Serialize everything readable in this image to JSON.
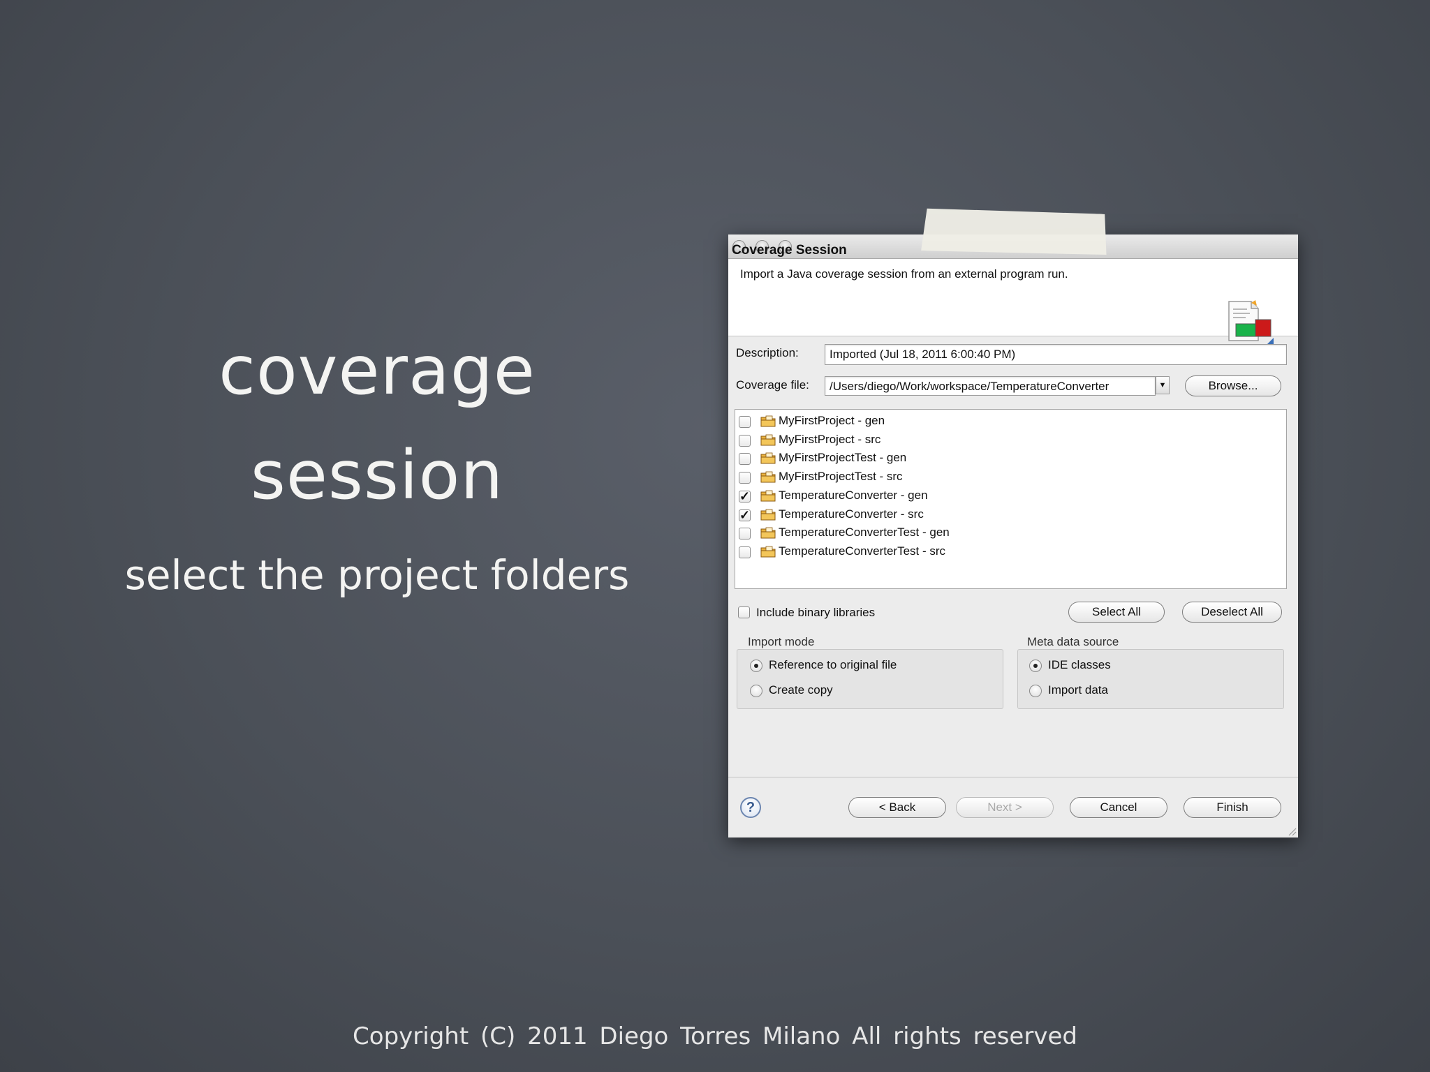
{
  "slide": {
    "title_line1": "coverage",
    "title_line2": "session",
    "subtitle": "select the project folders",
    "copyright": "Copyright (C) 2011  Diego Torres Milano  All rights reserved"
  },
  "dialog": {
    "header_title": "Coverage Session",
    "header_description": "Import a Java coverage session from an external program run.",
    "description_label": "Description:",
    "description_value": "Imported (Jul 18, 2011 6:00:40 PM)",
    "coverage_file_label": "Coverage file:",
    "coverage_file_value": "/Users/diego/Work/workspace/TemperatureConverter",
    "browse_label": "Browse...",
    "folders": [
      {
        "label": "MyFirstProject - gen",
        "checked": false
      },
      {
        "label": "MyFirstProject - src",
        "checked": false
      },
      {
        "label": "MyFirstProjectTest - gen",
        "checked": false
      },
      {
        "label": "MyFirstProjectTest - src",
        "checked": false
      },
      {
        "label": "TemperatureConverter - gen",
        "checked": true
      },
      {
        "label": "TemperatureConverter - src",
        "checked": true
      },
      {
        "label": "TemperatureConverterTest - gen",
        "checked": false
      },
      {
        "label": "TemperatureConverterTest - src",
        "checked": false
      }
    ],
    "include_binary_label": "Include binary libraries",
    "select_all_label": "Select All",
    "deselect_all_label": "Deselect All",
    "import_mode_label": "Import mode",
    "import_mode_options": [
      "Reference to original file",
      "Create copy"
    ],
    "import_mode_selected": "Reference to original file",
    "meta_source_label": "Meta data source",
    "meta_source_options": [
      "IDE classes",
      "Import data"
    ],
    "meta_source_selected": "IDE classes",
    "help_icon": "question-mark-icon",
    "back_label": "< Back",
    "next_label": "Next >",
    "cancel_label": "Cancel",
    "finish_label": "Finish"
  }
}
